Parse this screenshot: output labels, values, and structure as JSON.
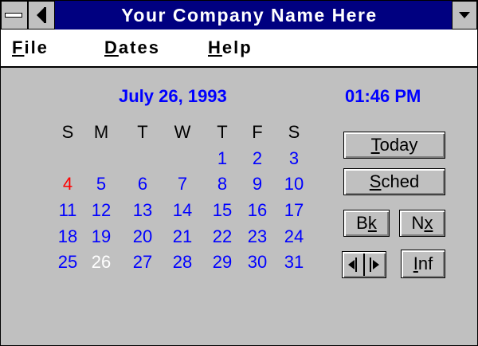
{
  "window": {
    "title": "Your Company Name Here"
  },
  "menu": [
    {
      "mnemonic": "F",
      "rest": "ile"
    },
    {
      "mnemonic": "D",
      "rest": "ates"
    },
    {
      "mnemonic": "H",
      "rest": "elp"
    }
  ],
  "header": {
    "date": "July 26, 1993",
    "time": "01:46 PM"
  },
  "calendar": {
    "weekdays": [
      "S",
      "M",
      "T",
      "W",
      "T",
      "F",
      "S"
    ],
    "weeks": [
      [
        "",
        "",
        "",
        "",
        "1",
        "2",
        "3"
      ],
      [
        "4",
        "5",
        "6",
        "7",
        "8",
        "9",
        "10"
      ],
      [
        "11",
        "12",
        "13",
        "14",
        "15",
        "16",
        "17"
      ],
      [
        "18",
        "19",
        "20",
        "21",
        "22",
        "23",
        "24"
      ],
      [
        "25",
        "26",
        "27",
        "28",
        "29",
        "30",
        "31"
      ]
    ],
    "highlight_red_day": "4",
    "selected_day": "26"
  },
  "buttons": {
    "today": {
      "mnemonic": "T",
      "rest": "oday"
    },
    "sched": {
      "mnemonic": "S",
      "rest": "ched"
    },
    "back": {
      "pre": "B",
      "mnemonic": "k",
      "rest": ""
    },
    "next": {
      "pre": "N",
      "mnemonic": "x",
      "rest": ""
    },
    "info": {
      "mnemonic": "I",
      "rest": "nf"
    }
  },
  "colors": {
    "title_bar": "#000080",
    "window_bg": "#c0c0c0",
    "date_text": "#0000ff",
    "holiday": "#ff0000",
    "selected_day": "#ffffff"
  },
  "icons": {
    "system_menu": "minus-bar-icon",
    "left": "back-arrow-icon",
    "dropdown": "chevron-down-icon",
    "prev_month": "arrow-left-icon",
    "next_month": "arrow-right-icon"
  }
}
